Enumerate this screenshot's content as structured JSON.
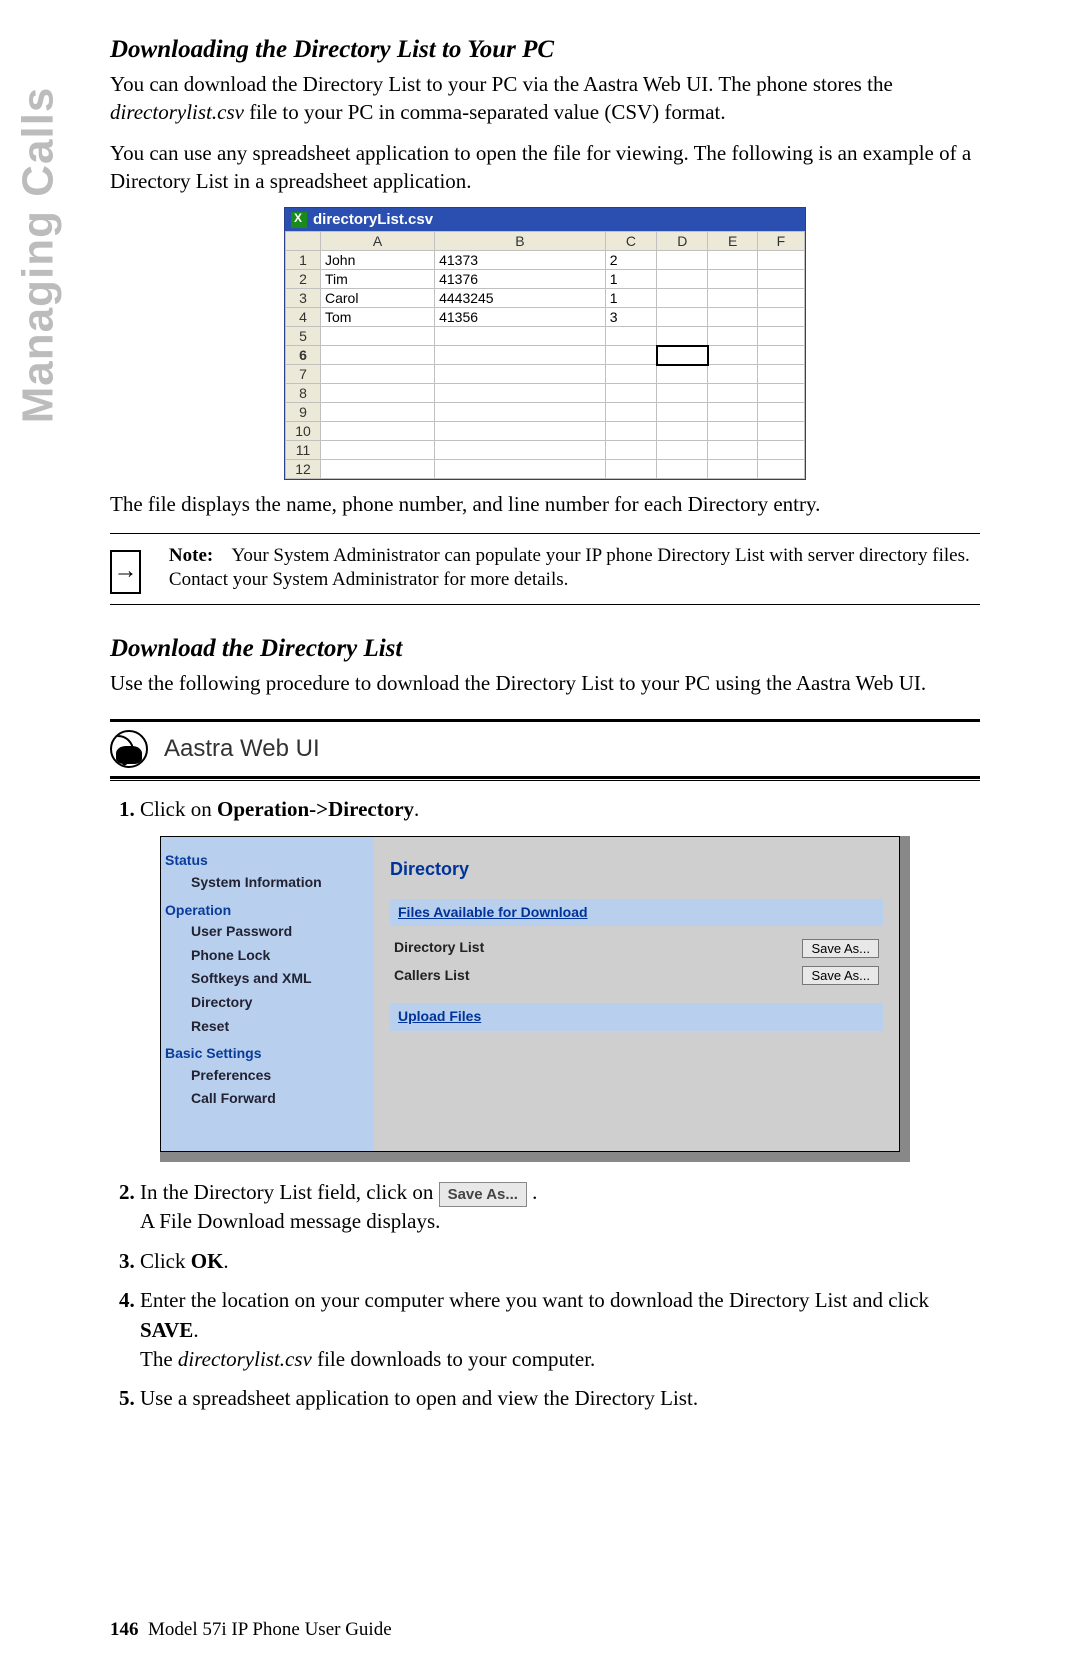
{
  "side_title": "Managing Calls",
  "heading1": "Downloading the Directory List to Your PC",
  "para1a": "You can download the Directory List to your PC via the Aastra Web UI. The phone stores the ",
  "para1b_file": "directorylist.csv",
  "para1c": " file to your PC in comma-separated value (CSV) format.",
  "para2": "You can use any spreadsheet application to open the file for viewing. The following is an example of a Directory List in a spreadsheet application.",
  "spreadsheet": {
    "title": "directoryList.csv",
    "cols": [
      "A",
      "B",
      "C",
      "D",
      "E",
      "F"
    ],
    "row_numbers": [
      "1",
      "2",
      "3",
      "4",
      "5",
      "6",
      "7",
      "8",
      "9",
      "10",
      "11",
      "12"
    ],
    "rows": [
      {
        "A": "John",
        "B": "41373",
        "C": "2"
      },
      {
        "A": "Tim",
        "B": "41376",
        "C": "1"
      },
      {
        "A": "Carol",
        "B": "4443245",
        "C": "1"
      },
      {
        "A": "Tom",
        "B": "41356",
        "C": "3"
      }
    ],
    "selected_row": 6,
    "selected_col": "D"
  },
  "para3": "The file displays the name, phone number, and line number for each Directory entry.",
  "note": {
    "label": "Note:",
    "text": "Your System Administrator can populate your IP phone Directory List with server directory files. Contact your System Administrator for more details."
  },
  "heading2": "Download the Directory List",
  "para4": "Use the following procedure to download the Directory List to your PC using the Aastra Web UI.",
  "aastra_label": "Aastra Web UI",
  "steps": {
    "s1a": "Click on ",
    "s1b": "Operation->Directory",
    "s1c": ".",
    "s2a": "In the Directory List field, click on ",
    "s2btn": "Save As...",
    "s2b": ".",
    "s2c": "A File Download message displays.",
    "s3a": "Click ",
    "s3b": "OK",
    "s3c": ".",
    "s4a": "Enter the location on your computer where you want to download the Directory List and click ",
    "s4b": "SAVE",
    "s4c": ".",
    "s4d_a": "The ",
    "s4d_file": "directorylist.csv",
    "s4d_b": " file downloads to your computer.",
    "s5": "Use a spreadsheet application to open and view the Directory List."
  },
  "webui": {
    "nav": {
      "status": "Status",
      "sysinfo": "System Information",
      "operation": "Operation",
      "userpw": "User Password",
      "phonelock": "Phone Lock",
      "softkeys": "Softkeys and XML",
      "directory": "Directory",
      "reset": "Reset",
      "basic": "Basic Settings",
      "prefs": "Preferences",
      "callfwd": "Call Forward"
    },
    "main": {
      "title": "Directory",
      "files_head": "Files Available for Download",
      "row1": "Directory List",
      "row2": "Callers List",
      "btn": "Save As...",
      "upload_head": "Upload Files"
    }
  },
  "footer": {
    "page": "146",
    "title": "Model 57i IP Phone User Guide"
  }
}
